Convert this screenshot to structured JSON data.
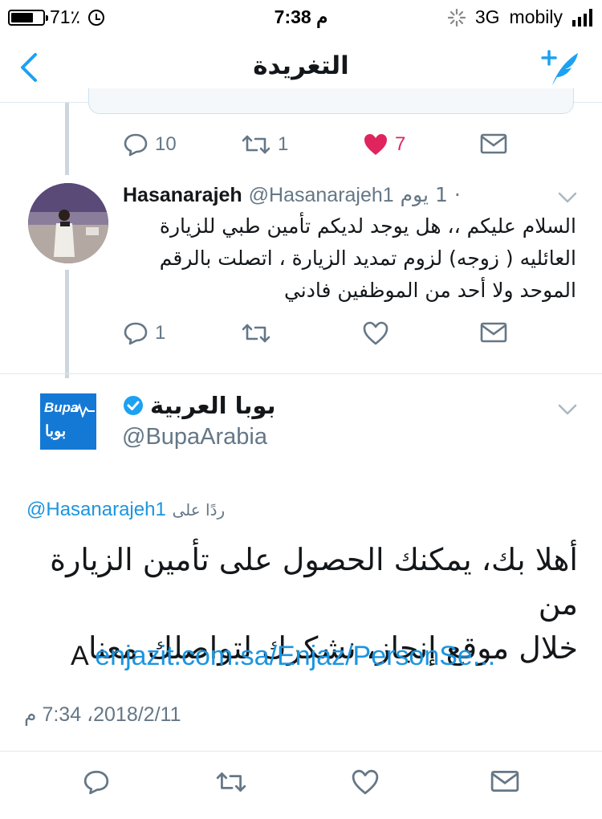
{
  "status_bar": {
    "battery": "71٪",
    "battery_level": 0.71,
    "time": "7:38 م",
    "network": "3G",
    "carrier": "mobily"
  },
  "nav": {
    "title": "التغريدة",
    "back_icon": "chevron-left-icon",
    "compose_icon": "compose-tweet-icon",
    "accent": "#1da1f2"
  },
  "quoted_tweet_actions": {
    "replies": "10",
    "retweets": "1",
    "likes": "7",
    "like_color": "#e0245e"
  },
  "reply_tweet": {
    "name": "Hasanarajeh",
    "handle": "@Hasanarajeh1",
    "time_ago": "· 1 يوم",
    "lines": [
      "السلام عليكم ،، هل يوجد لديكم تأمين طبي للزيارة",
      "العائليه ( زوجه) لزوم تمديد الزيارة ، اتصلت بالرقم",
      "الموحد ولا أحد من الموظفين فادني"
    ],
    "replies": "1"
  },
  "main_tweet": {
    "logo_en": "Bupa",
    "logo_ar": "بوبا",
    "name": "بوبا العربية",
    "handle": "@BupaArabia",
    "replying_label": "ردًا على",
    "replying_to": "@Hasanarajeh1",
    "lines": [
      "أهلا بك، يمكنك الحصول على تأمين الزيارة من",
      "خلال موقع إنجاز، نشكرك لتواصلك معنا"
    ],
    "link_prefix": "A",
    "link_text": "enjazit.com.sa/Enjaz/PersonSe...",
    "timestamp": "2018/2/11، 7:34 م",
    "brand_color": "#1479d5"
  }
}
